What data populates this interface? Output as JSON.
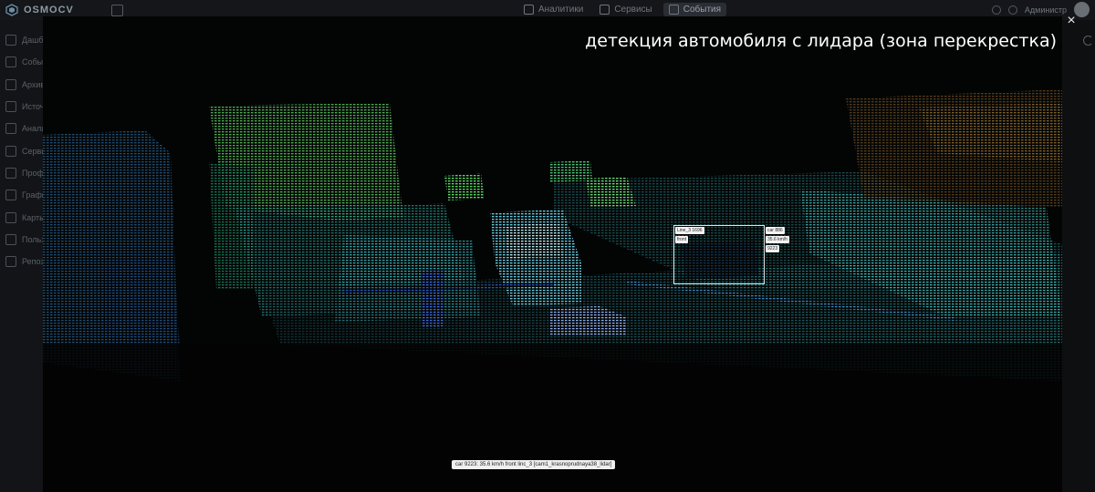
{
  "app": {
    "brand": "OSMOCV",
    "user_name": "Администр"
  },
  "top_tabs": [
    {
      "label": "Аналитики",
      "active": false,
      "icon": "analytics-icon"
    },
    {
      "label": "Сервисы",
      "active": false,
      "icon": "services-icon"
    },
    {
      "label": "События",
      "active": true,
      "icon": "events-icon"
    }
  ],
  "sidebar": {
    "items": [
      {
        "label": "Дашб",
        "icon": "dashboard-icon"
      },
      {
        "label": "Событ",
        "icon": "events-icon"
      },
      {
        "label": "Архив",
        "icon": "archive-icon"
      },
      {
        "label": "Источ",
        "icon": "sources-icon"
      },
      {
        "label": "Анали",
        "icon": "analytics-icon"
      },
      {
        "label": "Серви",
        "icon": "services-icon"
      },
      {
        "label": "Профи",
        "icon": "profile-icon"
      },
      {
        "label": "Графи",
        "icon": "graph-icon"
      },
      {
        "label": "Карты",
        "icon": "map-icon"
      },
      {
        "label": "Польз",
        "icon": "users-icon"
      },
      {
        "label": "Репоз",
        "icon": "repository-icon"
      }
    ]
  },
  "viewer": {
    "title": "детекция автомобиля с лидара (зона перекрестка)",
    "close_label": "×",
    "detection": {
      "left_tags": [
        "Line_3 1696",
        "front"
      ],
      "right_tags": [
        "car 886",
        "35.6 km/h",
        "9223"
      ]
    },
    "status_text": "car 9223: 35.6 km/h front linc_3 [cam1_krasnoprudnaya38_lidar]"
  },
  "colors": {
    "accent": "#2a2e34",
    "point_cloud_cyan": "#3fd0d6",
    "point_cloud_green": "#5ee06a",
    "point_cloud_blue": "#2b58c7"
  }
}
